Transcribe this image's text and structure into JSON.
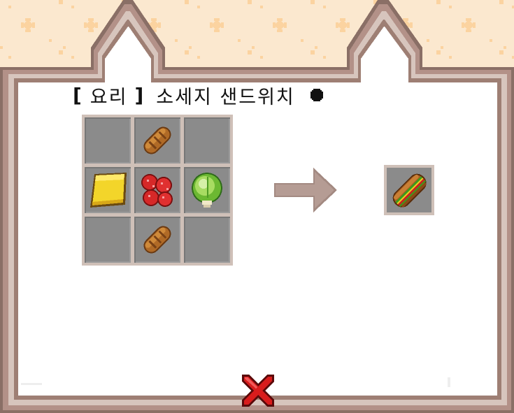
{
  "recipe": {
    "category_open": "[",
    "category_label": "요리",
    "category_close": "]",
    "recipe_name": "소세지 샌드위치"
  },
  "icons": {
    "title_dot": "black-circle-icon",
    "arrow": "right-arrow-icon",
    "close": "close-x-icon"
  },
  "crafting_grid": [
    [
      "",
      "bread",
      ""
    ],
    [
      "cheese",
      "sausage-slices",
      "lettuce"
    ],
    [
      "",
      "bread",
      ""
    ]
  ],
  "result": "sausage-sandwich",
  "colors": {
    "panel_border": "#a08176",
    "panel_fill": "#ffffff",
    "slot_fill": "#8b8b8b",
    "close_red": "#cc1818"
  }
}
